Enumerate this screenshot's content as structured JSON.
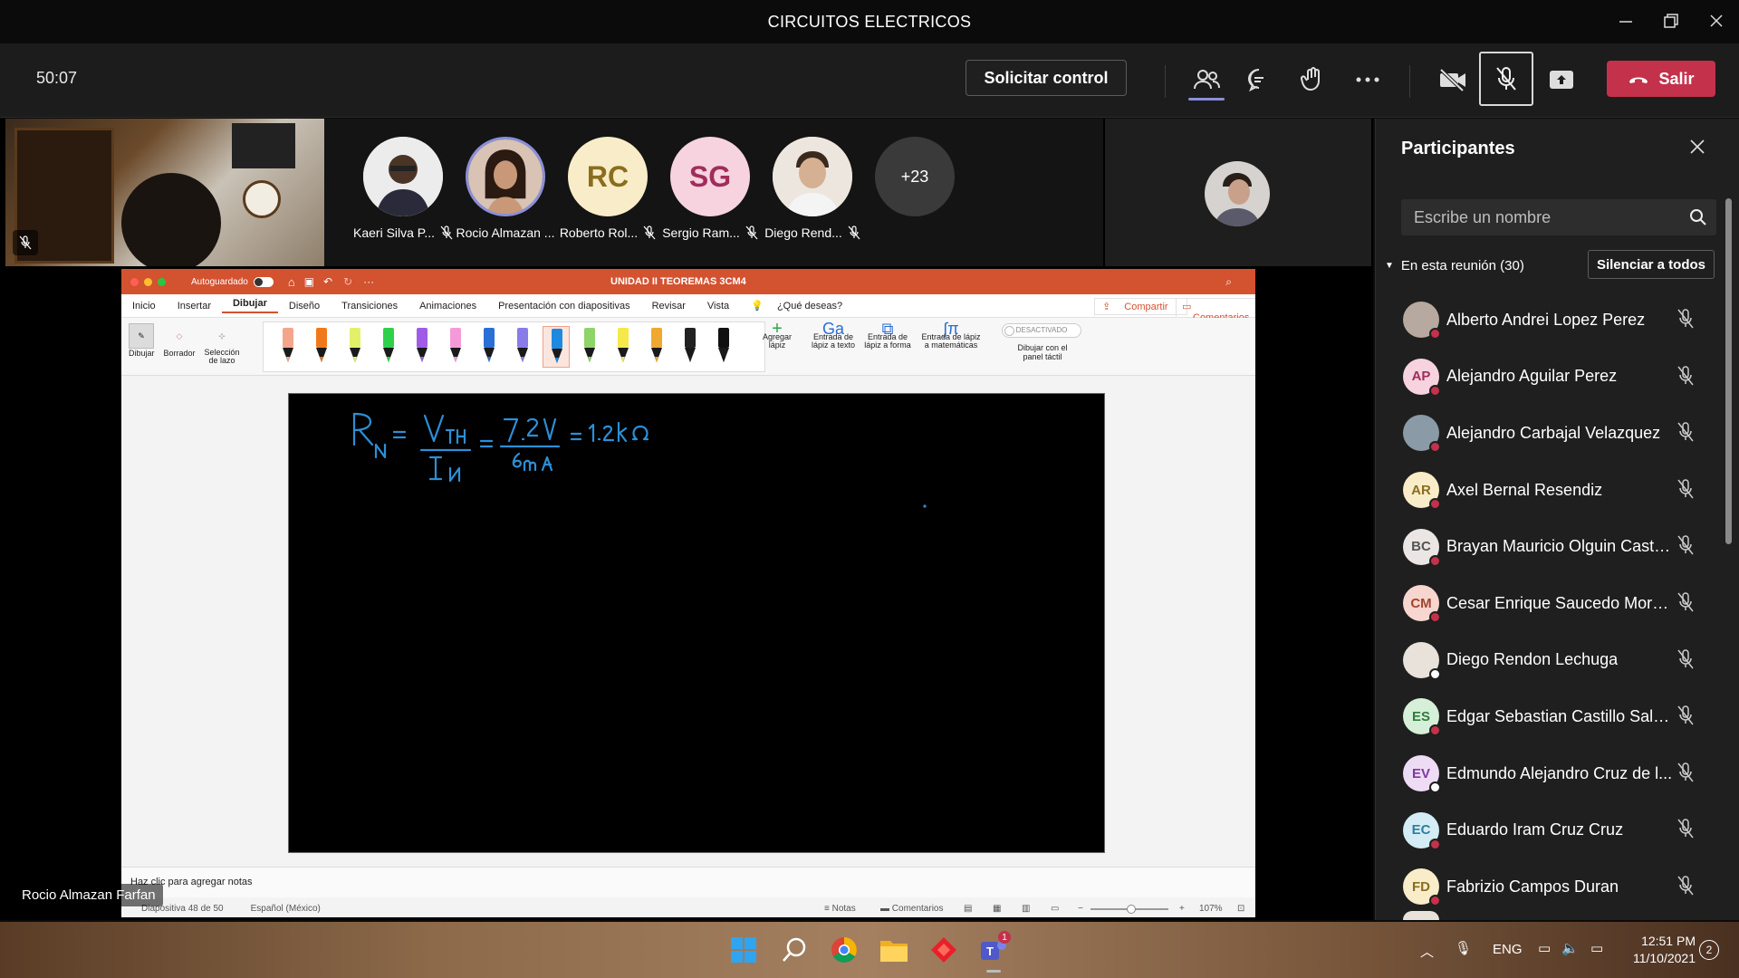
{
  "window": {
    "title": "CIRCUITOS ELECTRICOS"
  },
  "meeting": {
    "timer": "50:07",
    "request_control": "Solicitar control",
    "leave": "Salir"
  },
  "participant_strip": [
    {
      "name": "Kaeri Silva P...",
      "initials": "",
      "bg": "#e8e8e8",
      "fg": "#555"
    },
    {
      "name": "Rocio Almazan ...",
      "initials": "",
      "bg": "#c9a79a",
      "fg": "#333"
    },
    {
      "name": "Roberto Rol...",
      "initials": "RC",
      "bg": "#f8edc8",
      "fg": "#8a6d1f"
    },
    {
      "name": "Sergio Ram...",
      "initials": "SG",
      "bg": "#f6d3df",
      "fg": "#a02d5b"
    },
    {
      "name": "Diego Rend...",
      "initials": "",
      "bg": "#e8e2da",
      "fg": "#555"
    }
  ],
  "overflow_count": "+23",
  "presenter_caption": "Rocio Almazan Farfan",
  "ppt": {
    "autosave": "Autoguardado",
    "doc_title": "UNIDAD II TEOREMAS 3CM4",
    "tabs": [
      "Inicio",
      "Insertar",
      "Dibujar",
      "Diseño",
      "Transiciones",
      "Animaciones",
      "Presentación con diapositivas",
      "Revisar",
      "Vista"
    ],
    "tell_me": "¿Qué deseas?",
    "share": "Compartir",
    "comments": "Comentarios",
    "tools": {
      "draw": "Dibujar",
      "eraser": "Borrador",
      "lasso_1": "Selección",
      "lasso_2": "de lazo"
    },
    "ribbon": {
      "add_pen_1": "Agregar",
      "add_pen_2": "lápiz",
      "ink_text_1": "Entrada de",
      "ink_text_2": "lápiz a texto",
      "ink_shape_1": "Entrada de",
      "ink_shape_2": "lápiz a forma",
      "ink_math_1": "Entrada de lápiz",
      "ink_math_2": "a matemáticas",
      "toggle": "DESACTIVADO",
      "touch_1": "Dibujar con el",
      "touch_2": "panel táctil"
    },
    "pen_colors": [
      "#f4a68c",
      "#f07a1a",
      "#e3f06a",
      "#2fd14a",
      "#a05ce6",
      "#f59ad8",
      "#2a6fd6",
      "#8a7ce8",
      "#1d8ae0",
      "#8ed46a",
      "#f5e84a",
      "#f0a830",
      "#222222",
      "#111111"
    ],
    "notes_placeholder": "Haz clic para agregar notas",
    "status_slide": "Diapositiva 48 de 50",
    "status_lang": "Español (México)",
    "status_notes": "Notas",
    "status_comments": "Comentarios",
    "zoom": "107%"
  },
  "slide": {
    "ink": "R_N = V_TH / I_N = 7.2V / 6mA = 1.2kΩ",
    "ink_color": "#2d8fd6"
  },
  "panel": {
    "title": "Participantes",
    "search_placeholder": "Escribe un nombre",
    "group_label": "En esta reunión (30)",
    "mute_all": "Silenciar a todos",
    "participants": [
      {
        "name": "Alberto Andrei Lopez Perez",
        "initials": "",
        "bg": "#b7a9a0",
        "fg": "#333",
        "status": "#c4314b"
      },
      {
        "name": "Alejandro Aguilar Perez",
        "initials": "AP",
        "bg": "#f6d3df",
        "fg": "#a02d5b",
        "status": "#c4314b"
      },
      {
        "name": "Alejandro Carbajal Velazquez",
        "initials": "",
        "bg": "#8a9aa6",
        "fg": "#333",
        "status": "#c4314b"
      },
      {
        "name": "Axel Bernal Resendiz",
        "initials": "AR",
        "bg": "#f8edc8",
        "fg": "#8a6d1f",
        "status": "#c4314b"
      },
      {
        "name": "Brayan Mauricio Olguin Castillo",
        "initials": "BC",
        "bg": "#ebe6e3",
        "fg": "#555",
        "status": "#c4314b"
      },
      {
        "name": "Cesar Enrique Saucedo Moreno",
        "initials": "CM",
        "bg": "#f7d6cf",
        "fg": "#a0452d",
        "status": "#c4314b"
      },
      {
        "name": "Diego Rendon Lechuga",
        "initials": "",
        "bg": "#e8e2da",
        "fg": "#555",
        "status": "#ffffff"
      },
      {
        "name": "Edgar Sebastian Castillo Salga...",
        "initials": "ES",
        "bg": "#d6efd8",
        "fg": "#2e7d3a",
        "status": "#c4314b"
      },
      {
        "name": "Edmundo Alejandro Cruz de l...",
        "initials": "EV",
        "bg": "#eedcf5",
        "fg": "#7d3aa0",
        "status": "#ffffff"
      },
      {
        "name": "Eduardo Iram Cruz Cruz",
        "initials": "EC",
        "bg": "#d4ecf5",
        "fg": "#2d7fa0",
        "status": "#c4314b"
      },
      {
        "name": "Fabrizio Campos Duran",
        "initials": "FD",
        "bg": "#f8edc8",
        "fg": "#8a6d1f",
        "status": "#c4314b"
      }
    ]
  },
  "taskbar": {
    "lang": "ENG",
    "time": "12:51 PM",
    "date": "11/10/2021",
    "notif": "2",
    "teams_badge": "1"
  }
}
